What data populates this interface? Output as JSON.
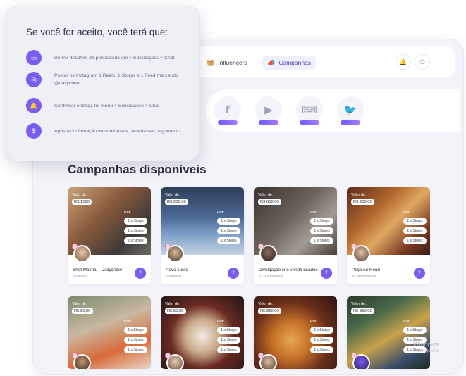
{
  "popup": {
    "title": "Se você for aceito, você terá que:",
    "steps": [
      {
        "icon": "chat-icon",
        "text": "Definir detalhes da publicidade em > Solicitações > Chat"
      },
      {
        "icon": "instagram-icon",
        "text": "Postar no Instagram 1 Reels, 1 Storys e 1 Feed marcando @dailycheer"
      },
      {
        "icon": "bell-icon",
        "text": "Confirmar entrega no menu > Solicitações > Chat"
      },
      {
        "icon": "money-bag-icon",
        "text": "Após a confirmação da contratante, receba seu pagamento"
      }
    ]
  },
  "nav": {
    "influencers_label": "Influencers",
    "campanhas_label": "Campanhas"
  },
  "socials": [
    {
      "icon": "facebook-icon",
      "glyph": "f"
    },
    {
      "icon": "youtube-icon",
      "glyph": "▶"
    },
    {
      "icon": "twitch-icon",
      "glyph": "⌨"
    },
    {
      "icon": "twitter-icon",
      "glyph": "🐦"
    }
  ],
  "section_title": "Campanhas disponíveis",
  "value_label": "Valor de:",
  "per_label": "Por:",
  "story_label": "1 x Storys",
  "cards": [
    {
      "price": "R$ 1500",
      "name": "Shot Matinal - Dailycheer",
      "category": "# Fitness"
    },
    {
      "price": "R$ 250,00",
      "name": "Novo curso",
      "category": "# Internet"
    },
    {
      "price": "R$ 650,00",
      "name": "Divulgação site venda usados",
      "category": "# Gastronomia"
    },
    {
      "price": "R$ 250,00",
      "name": "Peça no Rood",
      "category": "# Gastronomia"
    },
    {
      "price": "R$ 80,00",
      "name": "",
      "category": ""
    },
    {
      "price": "R$ 50,00",
      "name": "",
      "category": ""
    },
    {
      "price": "R$ 850,00",
      "name": "",
      "category": ""
    },
    {
      "price": "R$ 350,00",
      "name": "",
      "category": ""
    }
  ],
  "watermark": {
    "line1": "Windows",
    "line2": "nfigurações p"
  },
  "colors": {
    "accent": "#7a5cf0",
    "background": "#f3f4f9"
  }
}
